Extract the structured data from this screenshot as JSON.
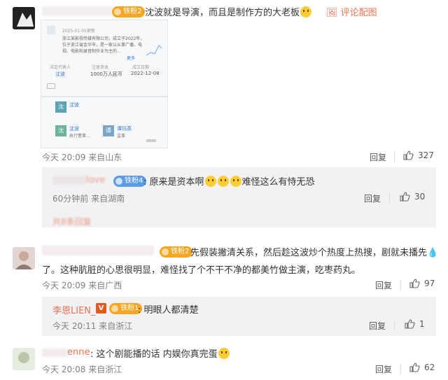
{
  "c1": {
    "badge": "铁粉2",
    "text": "沈波就是导演，而且是制作方的大老板",
    "comment_pic": "评论配图",
    "shot": {
      "date": "2025-01-05更新",
      "desc": "浙江某影视传媒有限公司，成立于2022年，位于浙江省金华市，是一家以从事广播、电视、电影和录音制作业为主的…",
      "more": "更多",
      "h1": "法定代表人",
      "h2": "注册资本",
      "h3": "成立日期",
      "v1": "沈波",
      "v2": "1000万人民币",
      "v3": "2022-12-08",
      "p1": "沈波",
      "p2": "沈波",
      "p2b": "执行董事…",
      "p3": "谭玛英",
      "p3b": "监事"
    },
    "time": "今天 20:09",
    "loc": "来自山东",
    "reply": "回复",
    "likes": "327"
  },
  "r1": {
    "name": "love",
    "badge": "铁粉4",
    "text_a": ": 原来是资本啊",
    "text_b": "难怪这么有恃无恐",
    "time": "60分钟前",
    "loc": "来自湖南",
    "reply": "回复",
    "likes": "30",
    "more": "共8条回复"
  },
  "c2": {
    "badge": "铁粉2",
    "line1": "先假装撇清关系，然后趁这波炒个热度上热搜，剧就未播先",
    "line2": "了。这种肮脏的心思很明显，难怪找了个不干不净的都美竹做主演，吃枣药丸。",
    "time": "今天 20:09",
    "loc": "来自广西",
    "reply": "回复",
    "likes": "97"
  },
  "r2": {
    "name": "李恩LIEN_",
    "badge": "铁粉1",
    "text": ": 明眼人都清楚",
    "time": "今天 20:11",
    "loc": "来自浙江",
    "reply": "回复",
    "likes": "1"
  },
  "c3": {
    "name": "enne",
    "text": ": 这个剧能播的话 内娱你真完蛋",
    "time": "今天 20:08",
    "loc": "来自浙江",
    "reply": "回复",
    "likes": "62"
  }
}
